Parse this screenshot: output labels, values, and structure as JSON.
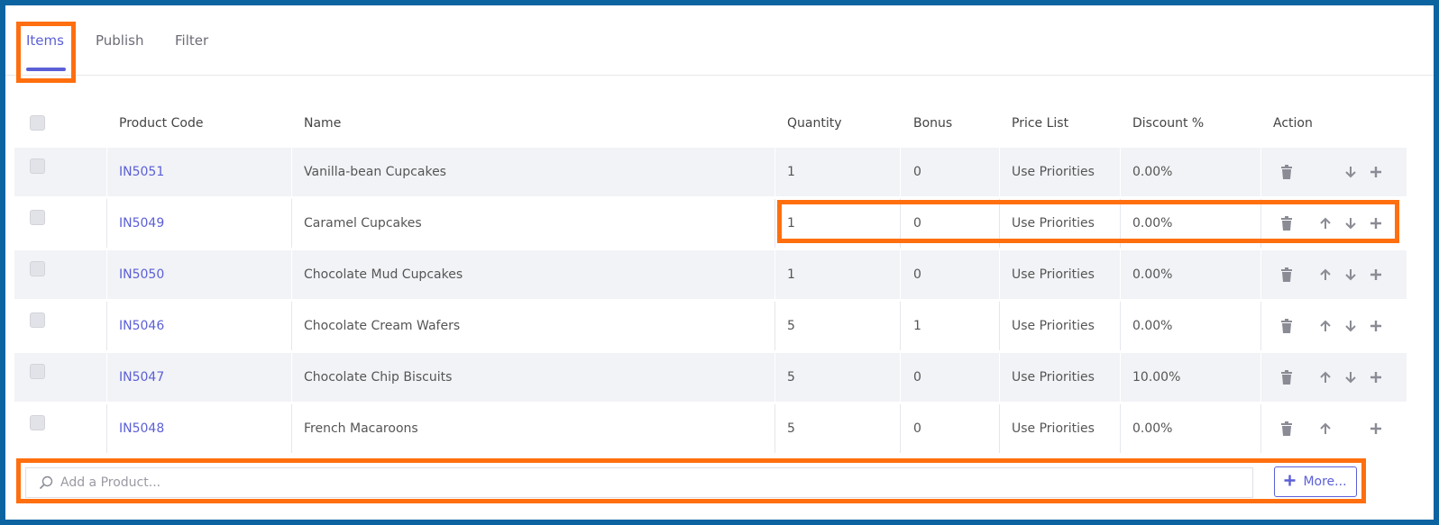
{
  "tabs": [
    {
      "label": "Items",
      "active": true
    },
    {
      "label": "Publish",
      "active": false
    },
    {
      "label": "Filter",
      "active": false
    }
  ],
  "table": {
    "headers": [
      "Product Code",
      "Name",
      "Quantity",
      "Bonus",
      "Price List",
      "Discount %",
      "Action"
    ],
    "rows": [
      {
        "code": "IN5051",
        "name": "Vanilla-bean Cupcakes",
        "quantity": "1",
        "bonus": "0",
        "price_list": "Use Priorities",
        "discount": "0.00%"
      },
      {
        "code": "IN5049",
        "name": "Caramel Cupcakes",
        "quantity": "1",
        "bonus": "0",
        "price_list": "Use Priorities",
        "discount": "0.00%"
      },
      {
        "code": "IN5050",
        "name": "Chocolate Mud Cupcakes",
        "quantity": "1",
        "bonus": "0",
        "price_list": "Use Priorities",
        "discount": "0.00%"
      },
      {
        "code": "IN5046",
        "name": "Chocolate Cream Wafers",
        "quantity": "5",
        "bonus": "1",
        "price_list": "Use Priorities",
        "discount": "0.00%"
      },
      {
        "code": "IN5047",
        "name": "Chocolate Chip Biscuits",
        "quantity": "5",
        "bonus": "0",
        "price_list": "Use Priorities",
        "discount": "10.00%"
      },
      {
        "code": "IN5048",
        "name": "French Macaroons",
        "quantity": "5",
        "bonus": "0",
        "price_list": "Use Priorities",
        "discount": "0.00%"
      }
    ]
  },
  "search": {
    "placeholder": "Add a Product..."
  },
  "more_button": {
    "label": "More..."
  },
  "colors": {
    "accent": "#5b5fd6",
    "highlight": "#ff6f0f",
    "frame": "#0b63a0"
  }
}
